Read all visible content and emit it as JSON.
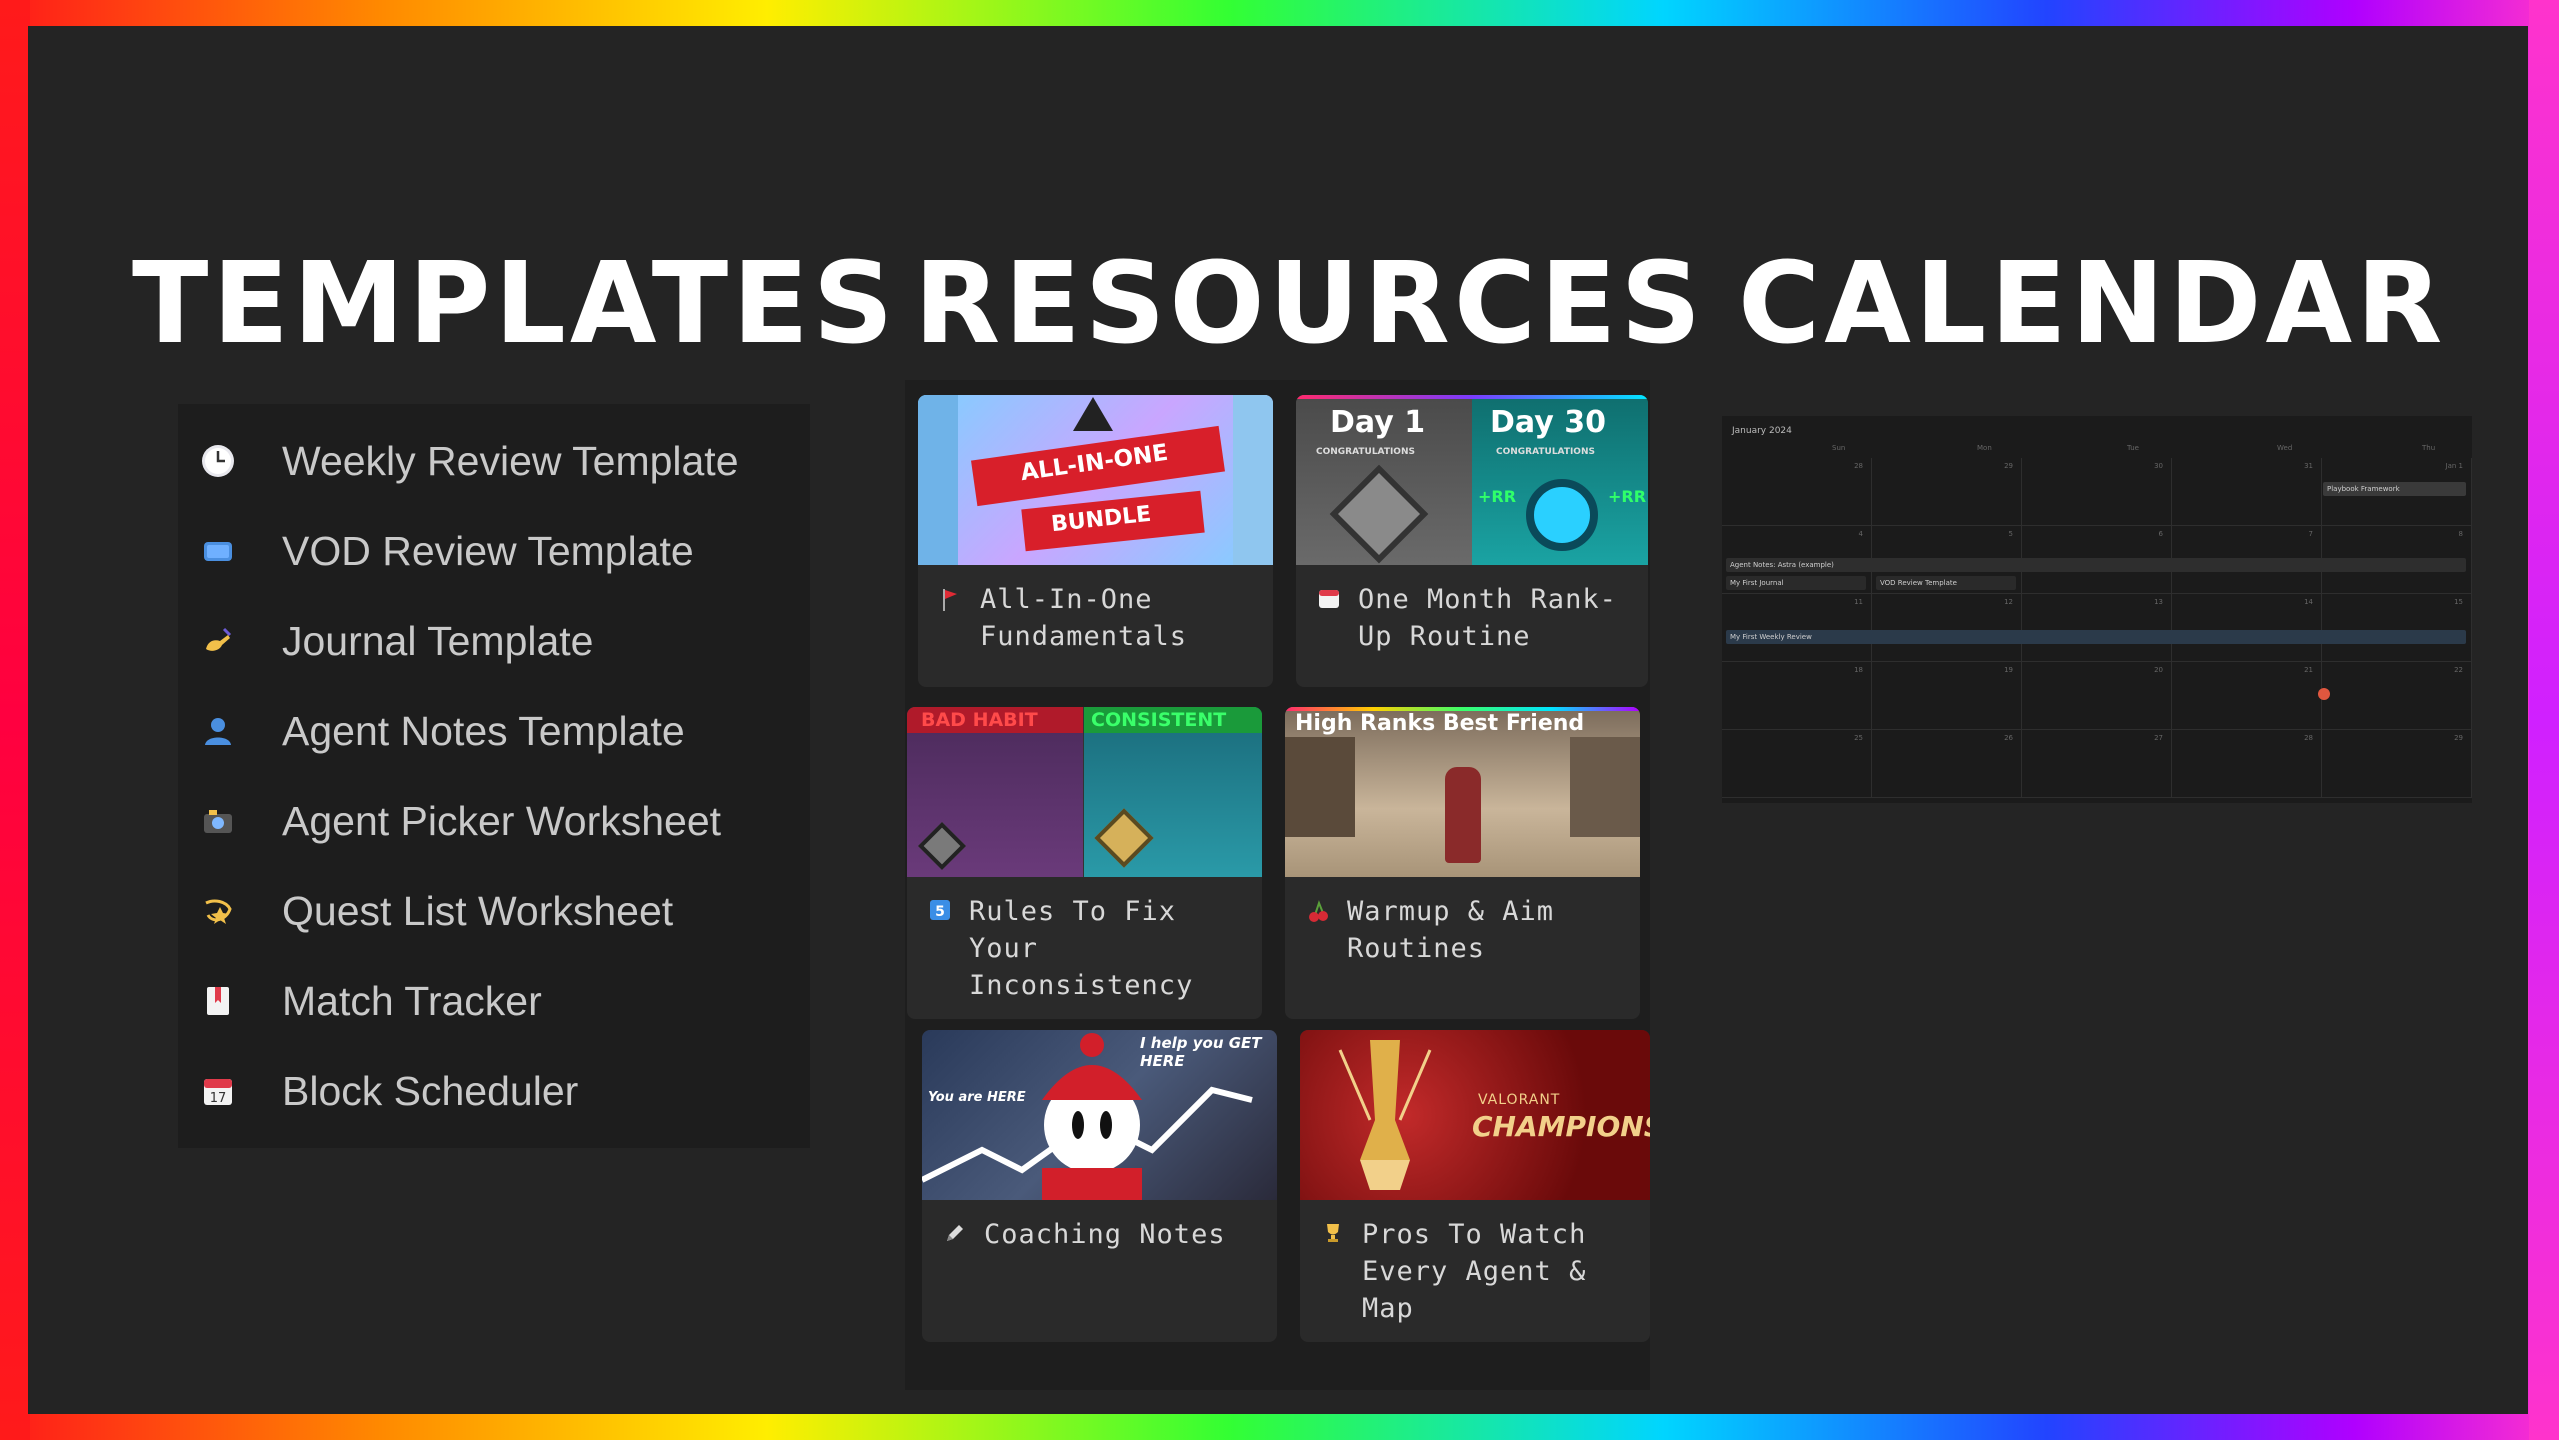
{
  "headings": {
    "templates": "TEMPLATES",
    "resources": "RESOURCES",
    "calendar": "CALENDAR"
  },
  "templates": {
    "items": [
      {
        "label": "Weekly Review Template",
        "icon": "clock-icon"
      },
      {
        "label": "VOD Review Template",
        "icon": "tv-icon"
      },
      {
        "label": "Journal Template",
        "icon": "writing-hand-icon"
      },
      {
        "label": "Agent Notes Template",
        "icon": "person-icon"
      },
      {
        "label": "Agent Picker Worksheet",
        "icon": "camera-icon"
      },
      {
        "label": "Quest List Worksheet",
        "icon": "comet-icon"
      },
      {
        "label": "Match Tracker",
        "icon": "bookmark-icon"
      },
      {
        "label": "Block Scheduler",
        "icon": "calendar-icon"
      }
    ]
  },
  "resources": {
    "cards": [
      {
        "title": "All-In-One Fundamentals",
        "icon": "red-flag-icon",
        "thumb_text": [
          "ALL-IN-ONE",
          "BUNDLE"
        ]
      },
      {
        "title": "One Month Rank-Up Routine",
        "icon": "calendar-icon",
        "thumb_text": [
          "Day 1",
          "Day 30",
          "CONGRATULATIONS",
          "CONGRATULATIONS",
          "+RR",
          "+RR"
        ]
      },
      {
        "title": "Rules To Fix Your Inconsistency",
        "icon": "number-5-icon",
        "thumb_text": [
          "BAD HABIT",
          "CONSISTENT"
        ]
      },
      {
        "title": "Warmup & Aim Routines",
        "icon": "cherries-icon",
        "thumb_text": [
          "High Ranks Best Friend"
        ]
      },
      {
        "title": "Coaching Notes",
        "icon": "pencil-icon",
        "thumb_text": [
          "You are HERE",
          "I help you GET HERE"
        ]
      },
      {
        "title": "Pros To Watch Every Agent & Map",
        "icon": "trophy-icon",
        "thumb_text": [
          "VALORANT",
          "CHAMPIONS"
        ]
      }
    ]
  },
  "calendar": {
    "month": "January 2024",
    "weekdays": [
      "Sun",
      "Mon",
      "Tue",
      "Wed",
      "Thu"
    ],
    "rows": [
      [
        "28",
        "29",
        "30",
        "31",
        "Jan 1"
      ],
      [
        "4",
        "5",
        "6",
        "7",
        "8"
      ],
      [
        "11",
        "12",
        "13",
        "14",
        "15"
      ],
      [
        "18",
        "19",
        "20",
        "21",
        "22"
      ],
      [
        "25",
        "26",
        "27",
        "28",
        "29"
      ]
    ],
    "events": [
      {
        "label": "Playbook Framework",
        "color": "#3a3a3a"
      },
      {
        "label": "Agent Notes: Astra (example)",
        "color": "#2e2e2e"
      },
      {
        "label": "My First Journal",
        "color": "#2a2a2a"
      },
      {
        "label": "VOD Review Template",
        "color": "#2a2a2a"
      },
      {
        "label": "My First Weekly Review",
        "color": "#2b3a4a"
      }
    ],
    "today_color": "#e0573f"
  }
}
